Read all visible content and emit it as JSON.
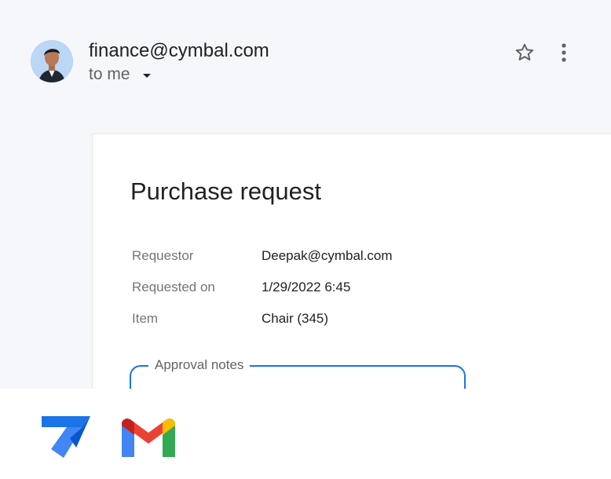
{
  "email": {
    "sender": "finance@cymbal.com",
    "recipient_label": "to me",
    "avatar_icon": "person-avatar",
    "star_icon": "star-outline-icon",
    "more_icon": "more-vert-icon"
  },
  "card": {
    "title": "Purchase request",
    "fields": [
      {
        "label": "Requestor",
        "value": "Deepak@cymbal.com"
      },
      {
        "label": "Requested on",
        "value": "1/29/2022 6:45"
      },
      {
        "label": "Item",
        "value": "Chair (345)"
      }
    ],
    "notes_label": "Approval notes",
    "notes_value": ""
  },
  "footer": {
    "logos": [
      "appsheet-logo",
      "gmail-logo"
    ]
  },
  "colors": {
    "background_top": "#f6f7fa",
    "card_border": "#e3e5e8",
    "accent_blue": "#1a73e8",
    "label_gray": "#70757a",
    "text_dark": "#202124"
  }
}
